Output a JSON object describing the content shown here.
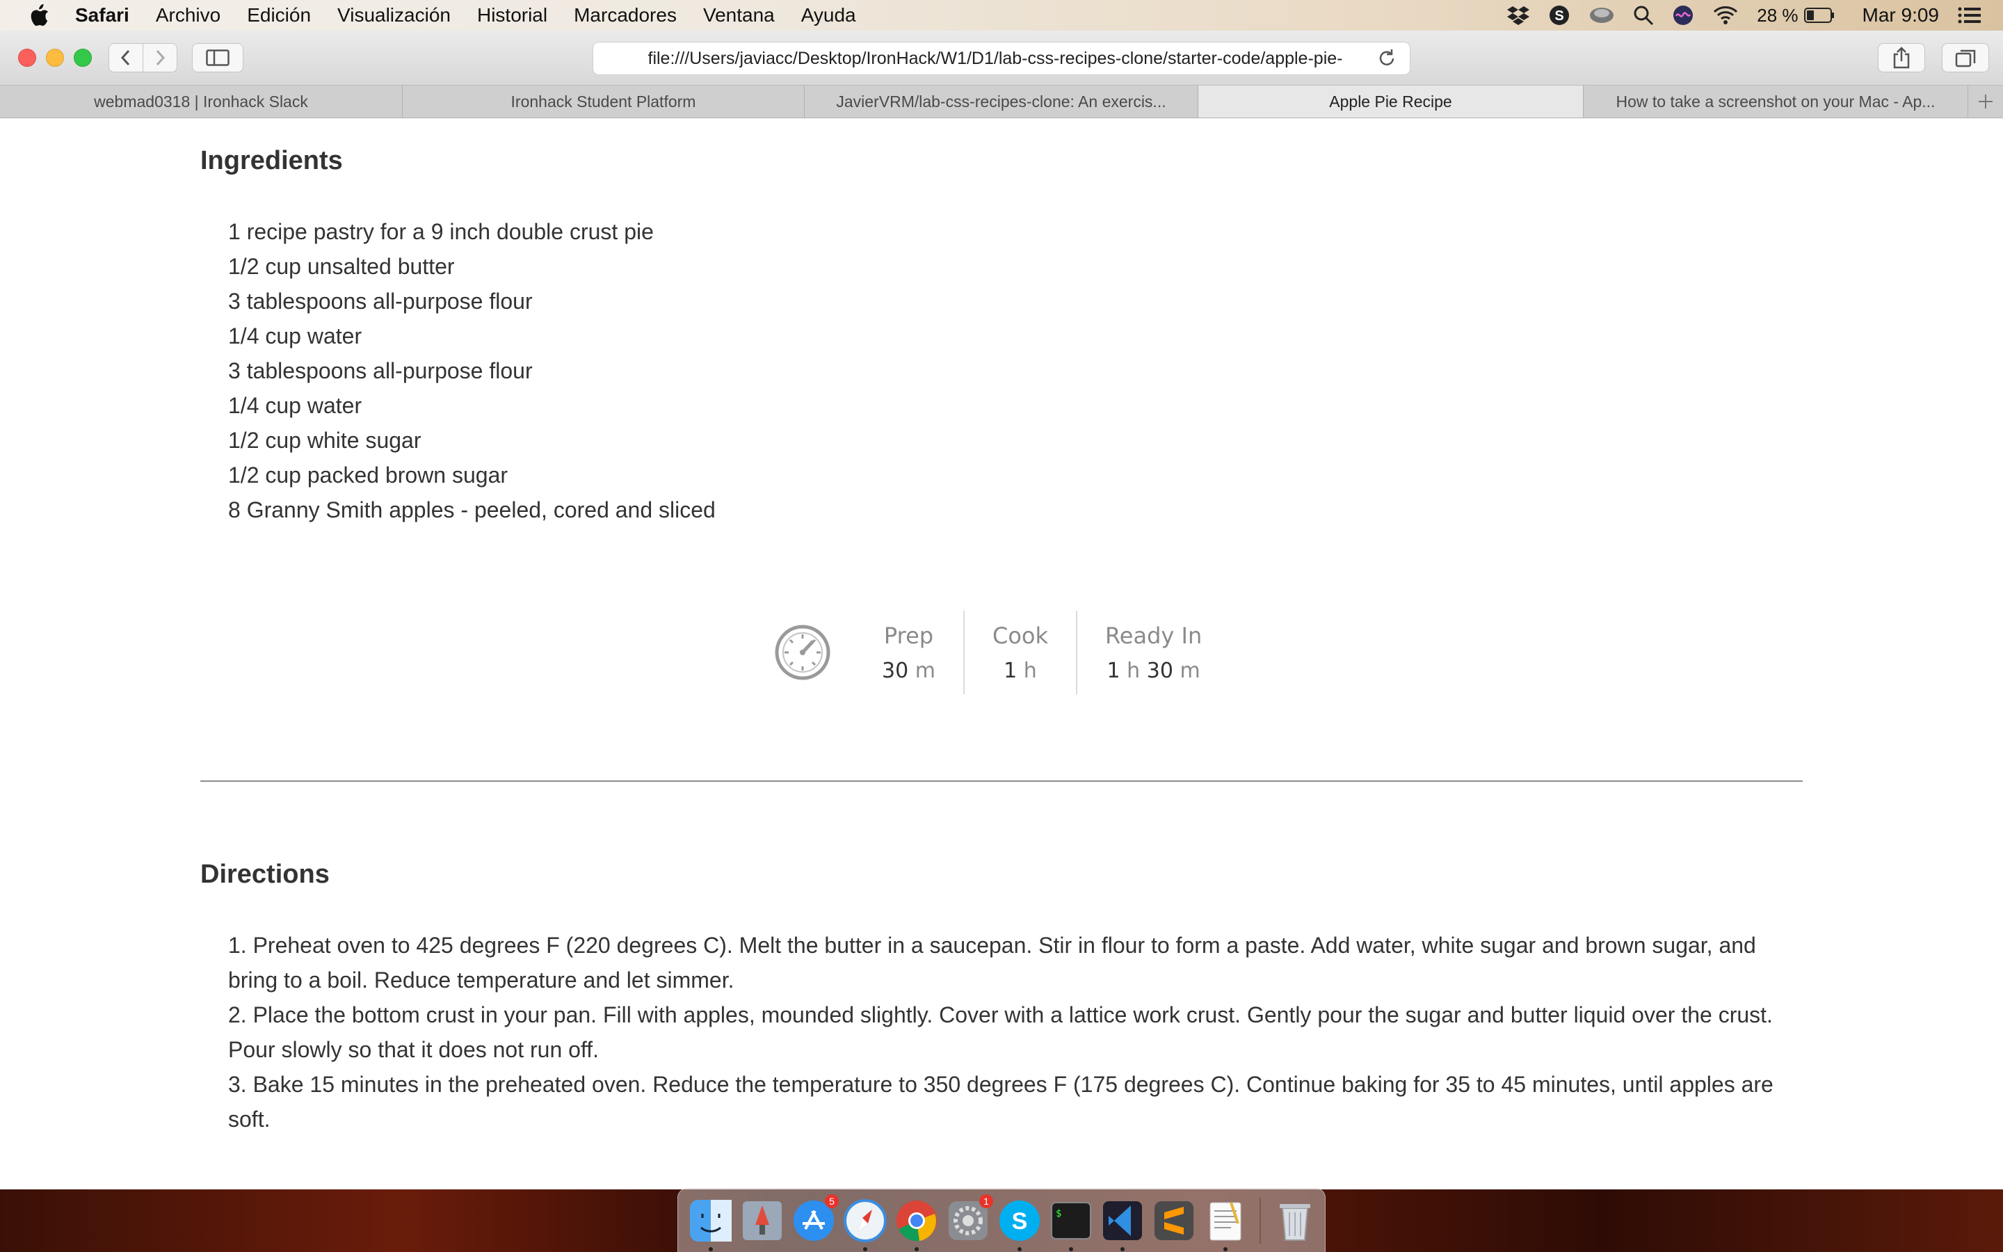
{
  "menubar": {
    "app_name": "Safari",
    "items": [
      "Archivo",
      "Edición",
      "Visualización",
      "Historial",
      "Marcadores",
      "Ventana",
      "Ayuda"
    ],
    "battery": "28 %",
    "clock": "Mar 9:09",
    "status_icons": [
      "dropbox-icon",
      "skype-icon",
      "app-icon",
      "spotlight-icon",
      "siri-icon",
      "wifi-icon",
      "battery-icon",
      "notification-center-icon"
    ]
  },
  "toolbar": {
    "url": "file:///Users/javiacc/Desktop/IronHack/W1/D1/lab-css-recipes-clone/starter-code/apple-pie-"
  },
  "tabs": [
    {
      "label": "webmad0318 | Ironhack Slack",
      "active": false
    },
    {
      "label": "Ironhack Student Platform",
      "active": false
    },
    {
      "label": "JavierVRM/lab-css-recipes-clone: An exercis...",
      "active": false
    },
    {
      "label": "Apple Pie Recipe",
      "active": true
    },
    {
      "label": "How to take a screenshot on your Mac - Ap...",
      "active": false
    }
  ],
  "recipe": {
    "ingredients_title": "Ingredients",
    "ingredients": [
      "1 recipe pastry for a 9 inch double crust pie",
      "1/2 cup unsalted butter",
      "3 tablespoons all-purpose flour",
      "1/4 cup water",
      "3 tablespoons all-purpose flour",
      "1/4 cup water",
      "1/2 cup white sugar",
      "1/2 cup packed brown sugar",
      "8 Granny Smith apples - peeled, cored and sliced"
    ],
    "times": {
      "prep_label": "Prep",
      "prep_num": "30",
      "prep_unit": "m",
      "cook_label": "Cook",
      "cook_num": "1",
      "cook_unit": "h",
      "ready_label": "Ready In",
      "ready_h": "1",
      "ready_h_unit": "h",
      "ready_m": "30",
      "ready_m_unit": "m"
    },
    "directions_title": "Directions",
    "directions": [
      "1. Preheat oven to 425 degrees F (220 degrees C). Melt the butter in a saucepan. Stir in flour to form a paste. Add water, white sugar and brown sugar, and bring to a boil. Reduce temperature and let simmer.",
      "2. Place the bottom crust in your pan. Fill with apples, mounded slightly. Cover with a lattice work crust. Gently pour the sugar and butter liquid over the crust. Pour slowly so that it does not run off.",
      "3. Bake 15 minutes in the preheated oven. Reduce the temperature to 350 degrees F (175 degrees C). Continue baking for 35 to 45 minutes, until apples are soft."
    ]
  },
  "dock": {
    "apps": [
      {
        "name": "finder-icon",
        "badge": "",
        "running": true
      },
      {
        "name": "launchpad-icon",
        "badge": "",
        "running": false
      },
      {
        "name": "app-store-icon",
        "badge": "5",
        "running": false
      },
      {
        "name": "safari-icon",
        "badge": "",
        "running": true
      },
      {
        "name": "chrome-icon",
        "badge": "",
        "running": true
      },
      {
        "name": "system-preferences-icon",
        "badge": "1",
        "running": false
      },
      {
        "name": "skype-app-icon",
        "badge": "",
        "running": true
      },
      {
        "name": "terminal-icon",
        "badge": "",
        "running": true
      },
      {
        "name": "vscode-icon",
        "badge": "",
        "running": true
      },
      {
        "name": "sublime-text-icon",
        "badge": "",
        "running": false
      },
      {
        "name": "textedit-icon",
        "badge": "",
        "running": true
      }
    ],
    "trash": "trash-icon"
  }
}
